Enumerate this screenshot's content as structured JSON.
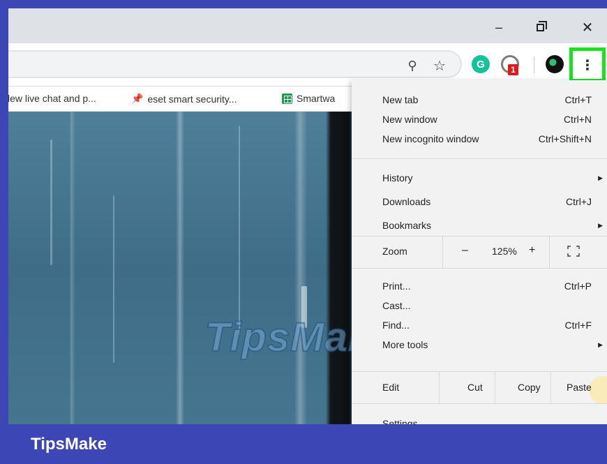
{
  "window": {
    "minimize": "–",
    "close": "✕"
  },
  "omnibox": {
    "zoom_icon": "⚲",
    "star_icon": "☆"
  },
  "extensions": {
    "grammarly": "G",
    "badge": "1",
    "menu_glyph": "⋮"
  },
  "bookmarks": [
    {
      "label": "lew live chat and p..."
    },
    {
      "label": "eset smart security..."
    },
    {
      "label": "Smartwa"
    }
  ],
  "watermark": "TipsMake",
  "menu": {
    "new_tab": {
      "label": "New tab",
      "shortcut": "Ctrl+T"
    },
    "new_window": {
      "label": "New window",
      "shortcut": "Ctrl+N"
    },
    "new_incognito": {
      "label": "New incognito window",
      "shortcut": "Ctrl+Shift+N"
    },
    "history": {
      "label": "History"
    },
    "downloads": {
      "label": "Downloads",
      "shortcut": "Ctrl+J"
    },
    "bookmarks": {
      "label": "Bookmarks"
    },
    "zoom": {
      "label": "Zoom",
      "minus": "–",
      "value": "125%",
      "plus": "+"
    },
    "print": {
      "label": "Print...",
      "shortcut": "Ctrl+P"
    },
    "cast": {
      "label": "Cast..."
    },
    "find": {
      "label": "Find...",
      "shortcut": "Ctrl+F"
    },
    "more_tools": {
      "label": "More tools"
    },
    "edit": {
      "label": "Edit",
      "cut": "Cut",
      "copy": "Copy",
      "paste": "Paste"
    },
    "settings": {
      "label": "Settings"
    },
    "submenu_arrow": "▶"
  },
  "caption": "TipsMake",
  "colors": {
    "frame": "#3c46b4",
    "highlight": "#19e21e",
    "menu_bg": "#f2f2f2"
  }
}
